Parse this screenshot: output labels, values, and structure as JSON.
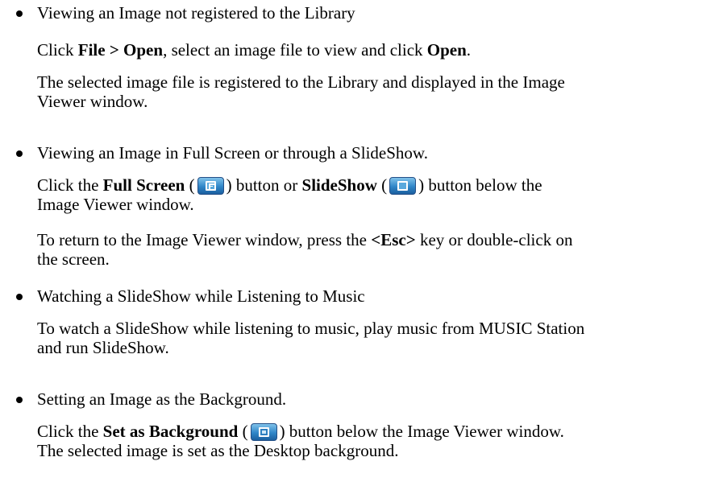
{
  "sections": [
    {
      "bullet": "Viewing an Image not registered to the Library",
      "p1": {
        "t1": "Click ",
        "b1": "File > Open",
        "t2": ", select an image file to view and click ",
        "b2": "Open",
        "t3": "."
      },
      "p2": {
        "line1": "The selected image file is registered to the Library and displayed in the Image",
        "line2": "Viewer window."
      }
    },
    {
      "bullet": "Viewing an Image in Full Screen or through a SlideShow.",
      "p1": {
        "t1": "Click the ",
        "b1": "Full Screen",
        "t2": " (",
        "t3": ") button or ",
        "b2": "SlideShow",
        "t4": " (",
        "t5": ") button below the",
        "line2": "Image Viewer window."
      },
      "p2": {
        "t1": "To return to the Image Viewer window, press the ",
        "b1": "<Esc>",
        "t2": " key or double-click on",
        "line2": "the screen."
      }
    },
    {
      "bullet": "Watching a SlideShow while Listening to Music",
      "p1": {
        "line1": "To watch a SlideShow while listening to music, play music from MUSIC Station",
        "line2": "and run SlideShow."
      }
    },
    {
      "bullet": "Setting an Image as the Background.",
      "p1": {
        "t1": "Click the ",
        "b1": "Set as Background",
        "t2": " (",
        "t3": ") button below the Image Viewer window.",
        "line2": "The selected image is set as the Desktop background."
      }
    }
  ],
  "icons": {
    "full_screen": "full-screen-icon",
    "slideshow": "slideshow-icon",
    "set_background": "set-as-background-icon"
  },
  "colors": {
    "button_light": "#7fc2ea",
    "button_dark": "#1b5f9f"
  }
}
